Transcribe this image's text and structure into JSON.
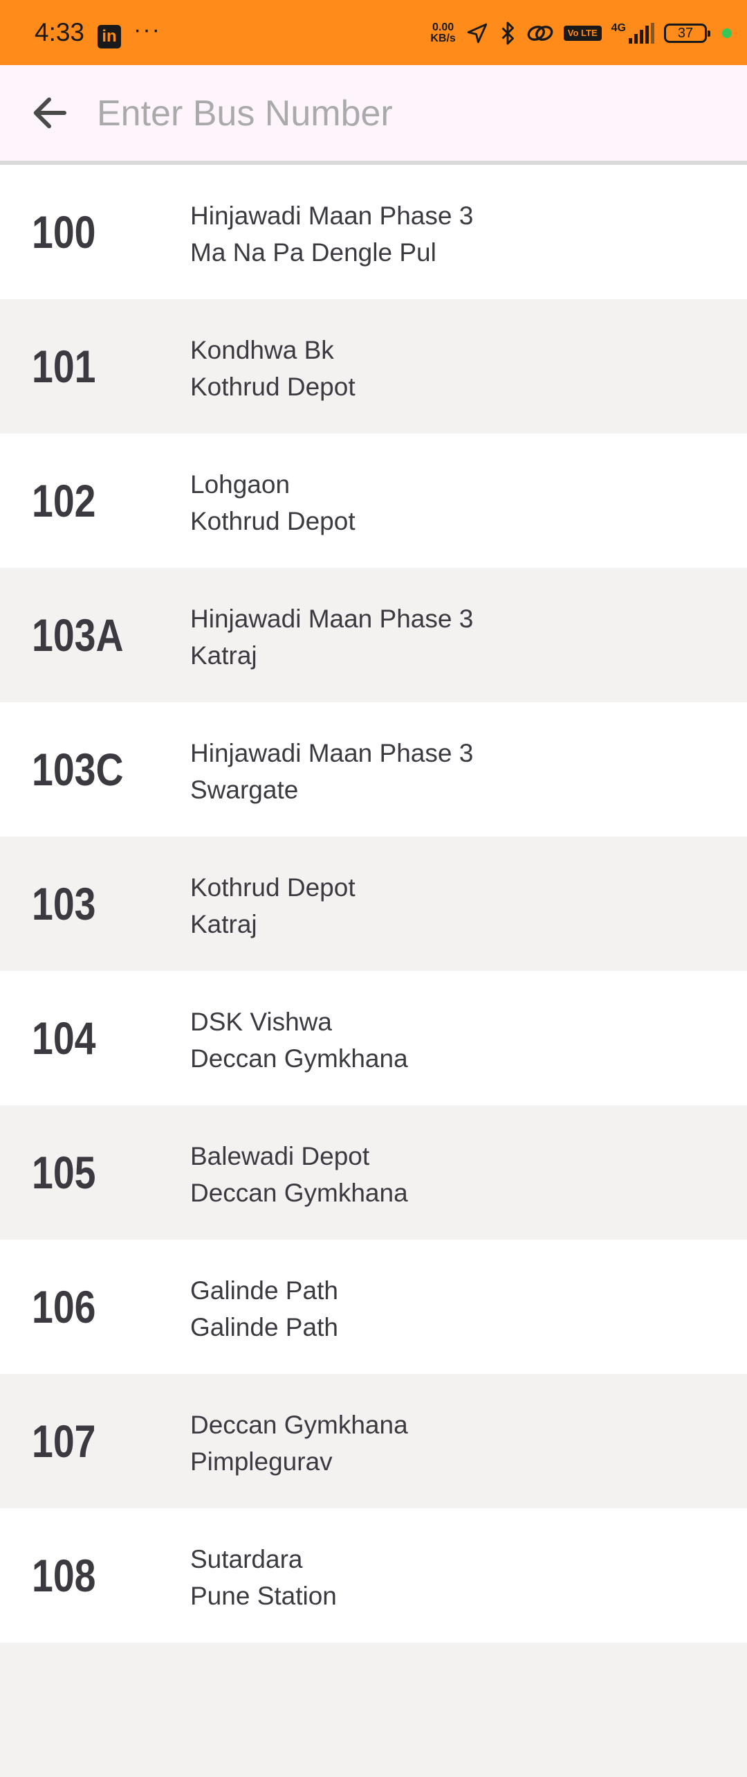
{
  "status_bar": {
    "time": "4:33",
    "app_icon": "linkedin-icon",
    "more": "···",
    "net_speed_value": "0.00",
    "net_speed_unit": "KB/s",
    "network": "4G",
    "volte": "Vo LTE",
    "battery": "37",
    "colors": {
      "background": "#ff8c1a",
      "dot": "#34c759"
    }
  },
  "search": {
    "placeholder": "Enter Bus Number",
    "value": "",
    "back_icon": "arrow-left-icon"
  },
  "routes": [
    {
      "number": "100",
      "from": "Hinjawadi Maan Phase 3",
      "to": "Ma Na Pa Dengle Pul"
    },
    {
      "number": "101",
      "from": "Kondhwa Bk",
      "to": "Kothrud Depot"
    },
    {
      "number": "102",
      "from": "Lohgaon",
      "to": "Kothrud Depot"
    },
    {
      "number": "103A",
      "from": "Hinjawadi Maan Phase 3",
      "to": "Katraj"
    },
    {
      "number": "103C",
      "from": "Hinjawadi Maan Phase 3",
      "to": "Swargate"
    },
    {
      "number": "103",
      "from": "Kothrud Depot",
      "to": "Katraj"
    },
    {
      "number": "104",
      "from": "DSK Vishwa",
      "to": "Deccan Gymkhana"
    },
    {
      "number": "105",
      "from": "Balewadi Depot",
      "to": "Deccan Gymkhana"
    },
    {
      "number": "106",
      "from": "Galinde Path",
      "to": "Galinde Path"
    },
    {
      "number": "107",
      "from": "Deccan Gymkhana",
      "to": "Pimplegurav"
    },
    {
      "number": "108",
      "from": "Sutardara",
      "to": "Pune Station"
    },
    {
      "number": "",
      "from": "",
      "to": ""
    }
  ]
}
